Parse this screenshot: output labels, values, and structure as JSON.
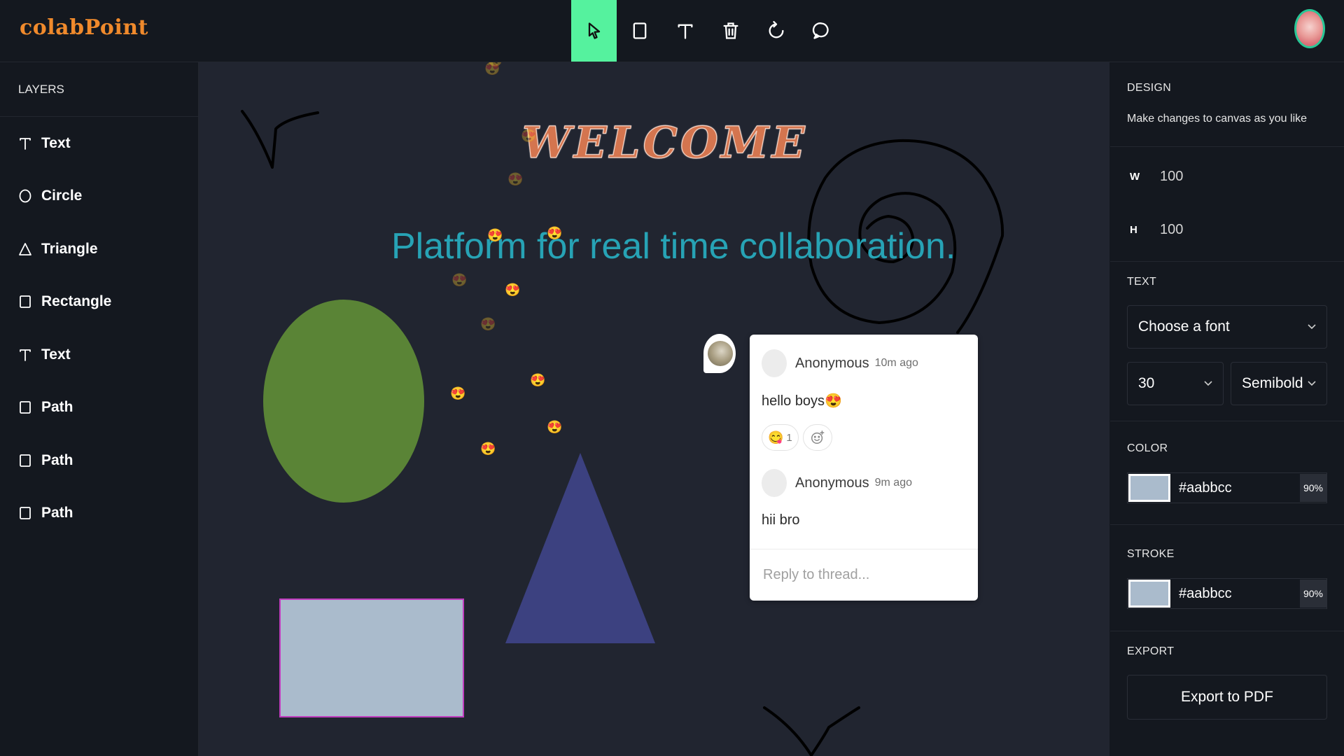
{
  "app": {
    "logo": "colabPoint"
  },
  "toolbar": {
    "tools": [
      {
        "name": "select",
        "icon": "cursor-icon",
        "active": true
      },
      {
        "name": "rectangle",
        "icon": "square-icon"
      },
      {
        "name": "text",
        "icon": "text-icon"
      },
      {
        "name": "delete",
        "icon": "trash-icon"
      },
      {
        "name": "reset",
        "icon": "refresh-icon"
      },
      {
        "name": "comments",
        "icon": "comment-icon"
      }
    ],
    "active_color": "#55f29e"
  },
  "layers": {
    "title": "LAYERS",
    "items": [
      {
        "label": "Text",
        "icon": "text-icon"
      },
      {
        "label": "Circle",
        "icon": "circle-icon"
      },
      {
        "label": "Triangle",
        "icon": "triangle-icon"
      },
      {
        "label": "Rectangle",
        "icon": "square-icon"
      },
      {
        "label": "Text",
        "icon": "text-icon"
      },
      {
        "label": "Path",
        "icon": "square-icon"
      },
      {
        "label": "Path",
        "icon": "square-icon"
      },
      {
        "label": "Path",
        "icon": "square-icon"
      }
    ]
  },
  "canvas": {
    "welcome_text": "WELCOME",
    "tagline": "Platform for real time collaboration.",
    "emoji_reaction": "😍",
    "colors": {
      "circle": "#5a8436",
      "triangle": "#3c4180",
      "rectangle": "#aabbcc",
      "rectangle_border": "#c03dbf",
      "tagline": "#27a3b5"
    }
  },
  "thread": {
    "messages": [
      {
        "author": "Anonymous",
        "time": "10m ago",
        "body": "hello boys😍"
      },
      {
        "author": "Anonymous",
        "time": "9m ago",
        "body": "hii bro"
      }
    ],
    "reaction": {
      "emoji": "😋",
      "count": "1"
    },
    "reply_placeholder": "Reply to thread..."
  },
  "design": {
    "title": "DESIGN",
    "subtitle": "Make changes to canvas as you like",
    "width_label": "W",
    "width_value": "100",
    "height_label": "H",
    "height_value": "100",
    "text_title": "TEXT",
    "font_placeholder": "Choose a font",
    "font_size": "30",
    "font_weight": "Semibold",
    "color_title": "COLOR",
    "color_hex": "#aabbcc",
    "color_opacity": "90%",
    "stroke_title": "STROKE",
    "stroke_hex": "#aabbcc",
    "stroke_opacity": "90%",
    "export_title": "EXPORT",
    "export_label": "Export to PDF"
  }
}
